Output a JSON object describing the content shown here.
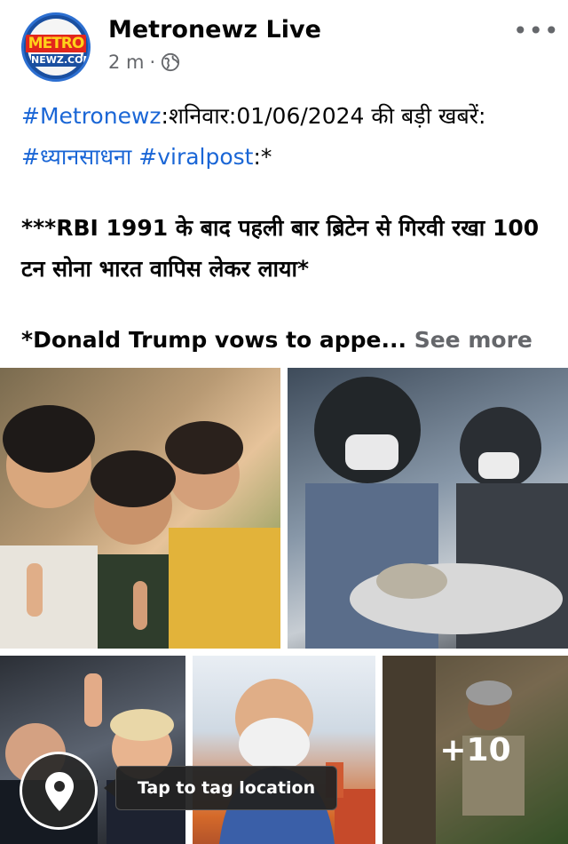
{
  "post": {
    "page_name": "Metronewz Live",
    "time": "2 m",
    "separator": "·",
    "avatar_text_top": "METRO",
    "avatar_text_bottom": "NEWZ.COM",
    "more_label": "•••",
    "text": {
      "line1_tag1": "#Metronewz",
      "line1_rest": ":शनिवार:01/06/2024 की बड़ी खबरें: ",
      "line1_tag2": "#ध्यानसाधना",
      "line1_space": " ",
      "line1_tag3": "#viralpost",
      "line1_end": ":*",
      "para2": "***RBI 1991 के बाद पहली बार ब्रिटेन से गिरवी रखा 100 टन सोना भारत वापिस लेकर लाया*",
      "para3": "*Donald Trump vows to appe...",
      "see_more": " See more"
    },
    "photos": {
      "more_count": "+10"
    },
    "location_tooltip": "Tap to tag location"
  },
  "icons": {
    "globe": "globe-icon",
    "location": "location-pin-icon",
    "more": "more-options-icon"
  },
  "colors": {
    "hashtag": "#1a66d6",
    "secondary_text": "#65676b"
  }
}
